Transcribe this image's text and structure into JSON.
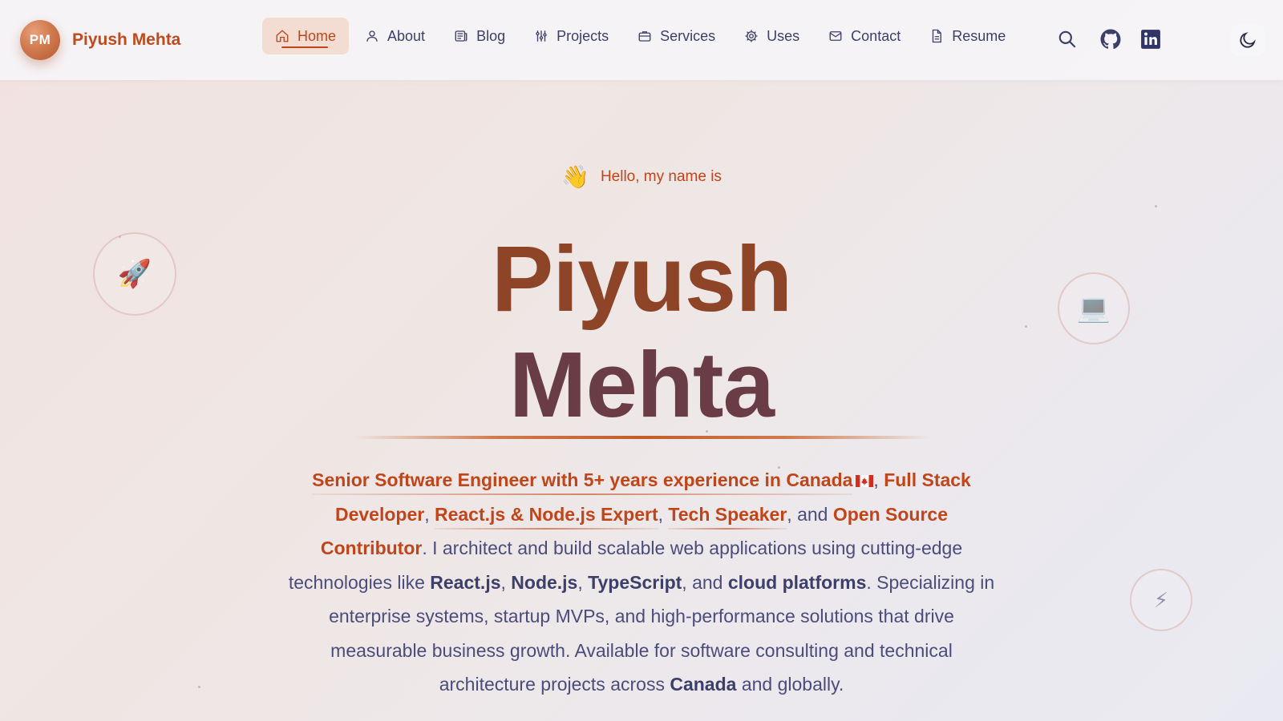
{
  "brand": {
    "initials": "PM",
    "name": "Piyush Mehta"
  },
  "nav": {
    "items": [
      {
        "label": "Home",
        "icon": "home-icon",
        "active": true
      },
      {
        "label": "About",
        "icon": "user-icon",
        "active": false
      },
      {
        "label": "Blog",
        "icon": "newspaper-icon",
        "active": false
      },
      {
        "label": "Projects",
        "icon": "sliders-icon",
        "active": false
      },
      {
        "label": "Services",
        "icon": "briefcase-icon",
        "active": false
      },
      {
        "label": "Uses",
        "icon": "gear-icon",
        "active": false
      },
      {
        "label": "Contact",
        "icon": "mail-icon",
        "active": false
      },
      {
        "label": "Resume",
        "icon": "document-icon",
        "active": false
      }
    ]
  },
  "tools": [
    "search-icon",
    "github-icon",
    "linkedin-icon",
    "moon-icon"
  ],
  "hero": {
    "wave_emoji": "👋",
    "greeting": "Hello, my name is",
    "first_name": "Piyush",
    "last_name": "Mehta",
    "intro": {
      "hl_1": "Senior Software Engineer with 5+ years experience in Canada",
      "sep_1": ",",
      "hl_2": "Full Stack Developer",
      "sep_2": ",",
      "hl_3": "React.js & Node.js Expert",
      "sep_3": ",",
      "hl_4": "Tech Speaker",
      "sep_4": ", and",
      "hl_5": "Open Source Contributor",
      "text_1": ". I architect and build scalable web applications using cutting-edge technologies like",
      "tech_1": "React.js",
      "sep_5": ",",
      "tech_2": "Node.js",
      "sep_6": ",",
      "tech_3": "TypeScript",
      "sep_7": ", and",
      "tech_4": "cloud platforms",
      "text_2": ". Specializing in enterprise systems, startup MVPs, and high-performance solutions that drive measurable business growth. Available for software consulting and technical architecture projects across",
      "place": "Canada",
      "text_3": "and globally."
    },
    "floating_badges": [
      "🚀",
      "💻",
      "⚡"
    ]
  },
  "colors": {
    "accent": "#c2451a",
    "text": "#4b4c7c",
    "nav_text": "#3c3f6a",
    "active_bg": "#f3ddd3"
  }
}
